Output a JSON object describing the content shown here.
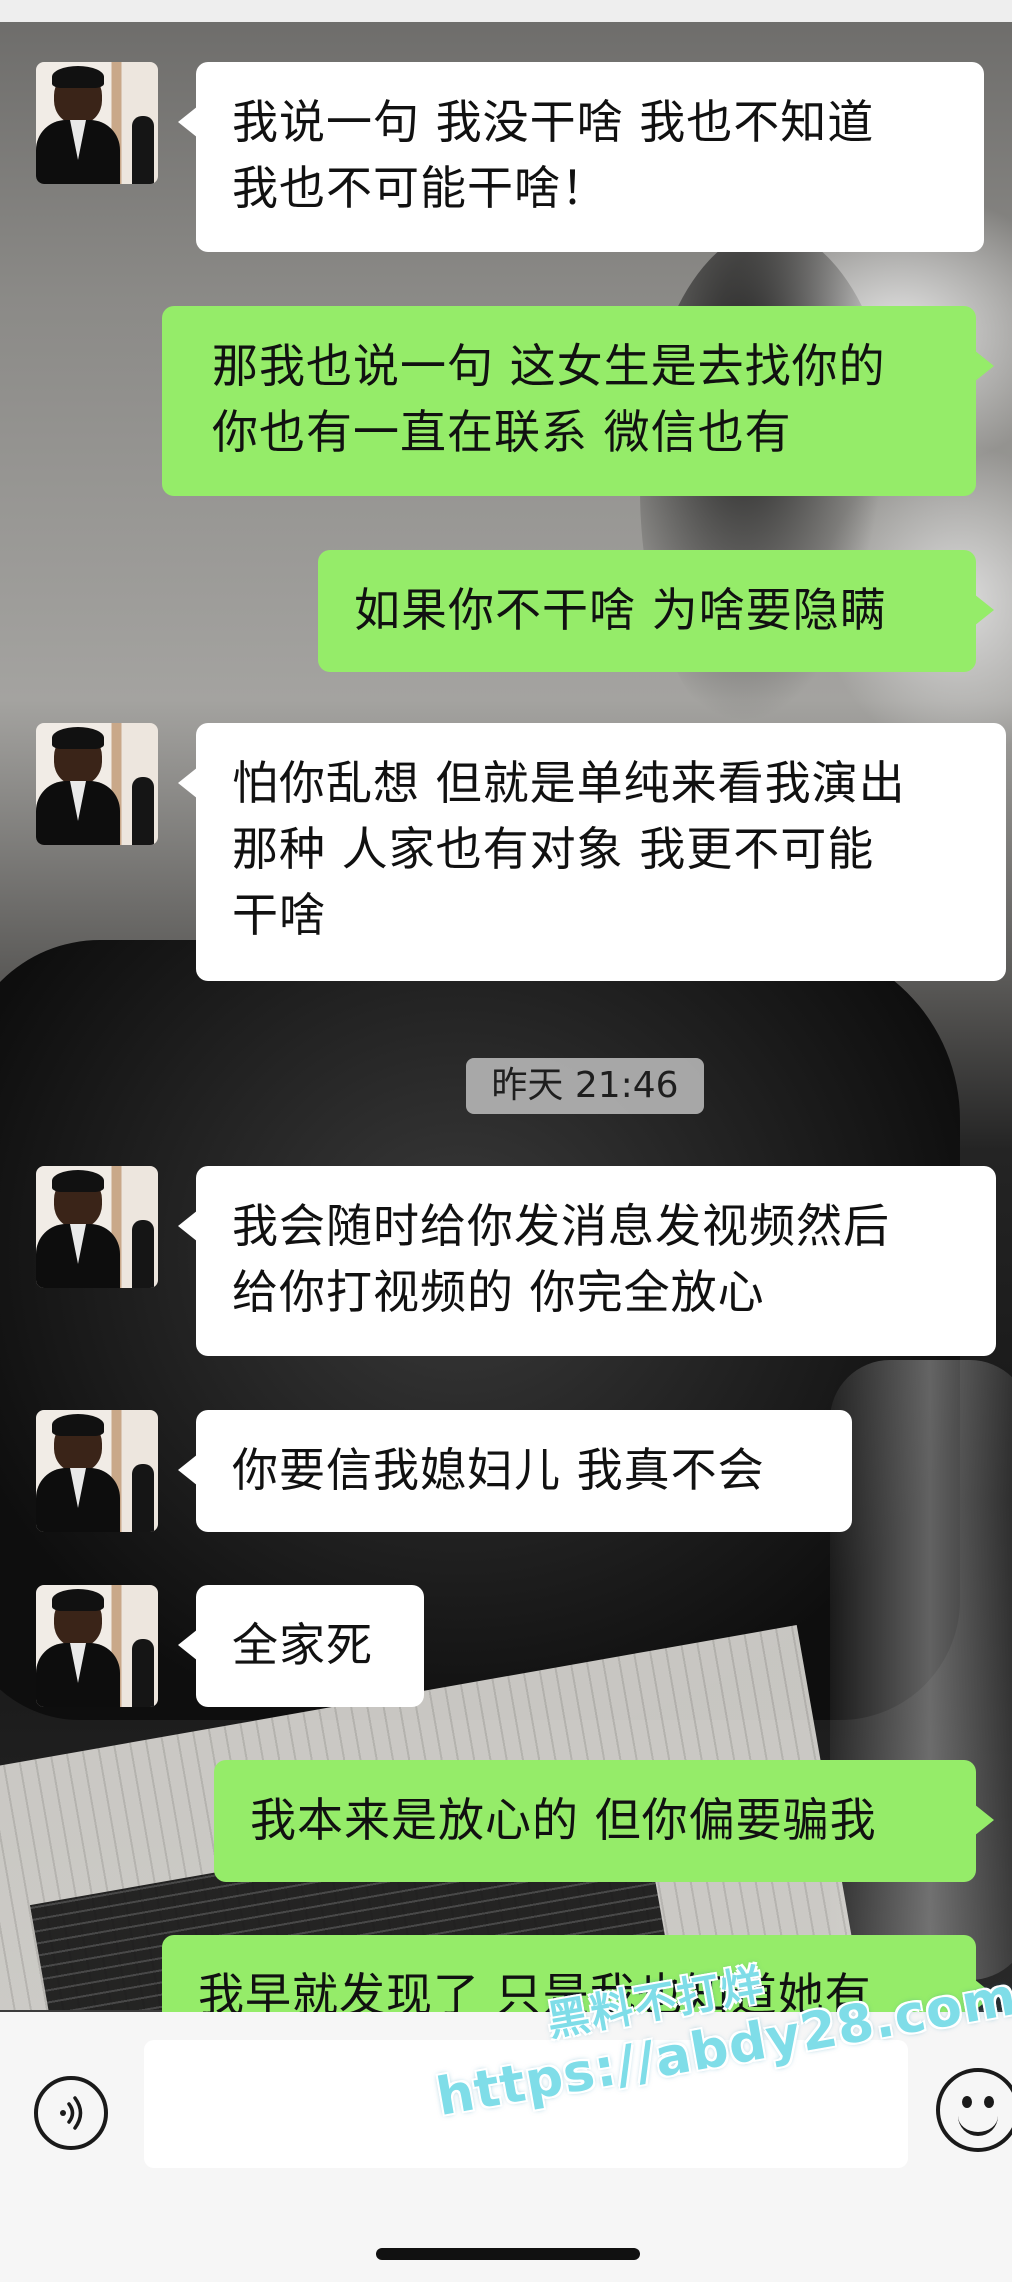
{
  "conversation": {
    "messages": [
      {
        "side": "left",
        "text": "我说一句 我没干啥 我也不知道\n我也不可能干啥！"
      },
      {
        "side": "right",
        "text": "那我也说一句 这女生是去找你的\n你也有一直在联系 微信也有"
      },
      {
        "side": "right",
        "text": "如果你不干啥 为啥要隐瞒"
      },
      {
        "side": "left",
        "text": "怕你乱想 但就是单纯来看我演出\n那种 人家也有对象 我更不可能\n干啥"
      },
      {
        "side": "left",
        "text": "我会随时给你发消息发视频然后\n给你打视频的 你完全放心"
      },
      {
        "side": "left",
        "text": "你要信我媳妇儿 我真不会"
      },
      {
        "side": "left",
        "text": "全家死"
      },
      {
        "side": "right",
        "text": "我本来是放心的 但你偏要骗我"
      },
      {
        "side": "right",
        "text": "我早就发现了 只是我也知道她有"
      }
    ],
    "timestamp": "昨天 21:46"
  },
  "input_bar": {
    "voice_icon": "voice-input-icon",
    "emoji_icon": "emoji-icon",
    "text_value": ""
  },
  "watermark": {
    "chinese": "黑料不打烊",
    "url": "https://abdy28.com"
  }
}
